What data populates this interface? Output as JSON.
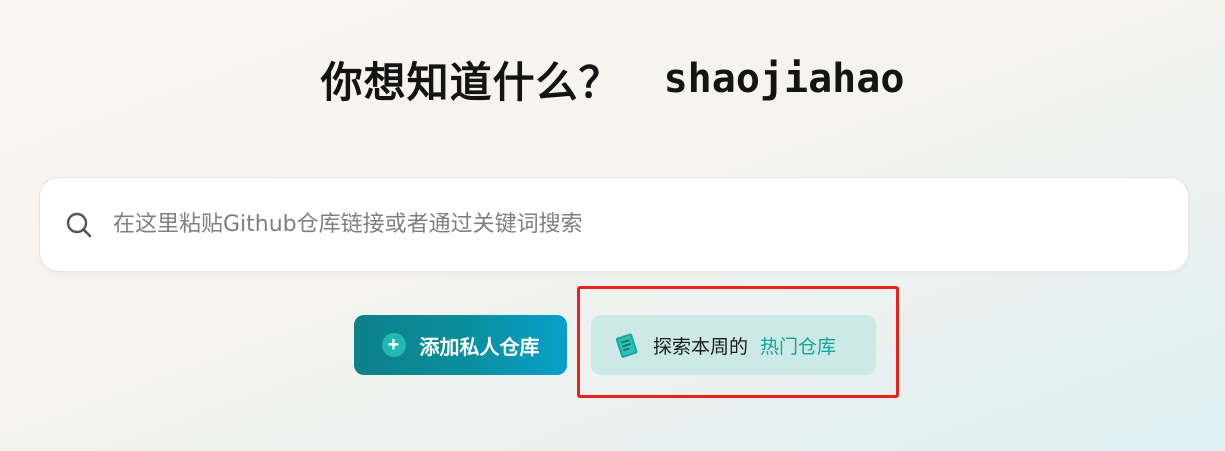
{
  "heading": {
    "question": "你想知道什么？",
    "username": "shaojiahao"
  },
  "search": {
    "placeholder": "在这里粘贴Github仓库链接或者通过关键词搜索",
    "value": "",
    "icon": "search-icon"
  },
  "buttons": {
    "add_private_repo": {
      "label": "添加私人仓库",
      "icon": "plus-circle-icon"
    },
    "explore_weekly": {
      "prefix": "探索本周的",
      "highlight": "热门仓库",
      "icon": "book-icon"
    }
  },
  "colors": {
    "accent_teal": "#0a8f9e",
    "highlight_red": "#e8231c",
    "hot_text": "#11a69a",
    "explore_bg": "#cce9e7"
  }
}
